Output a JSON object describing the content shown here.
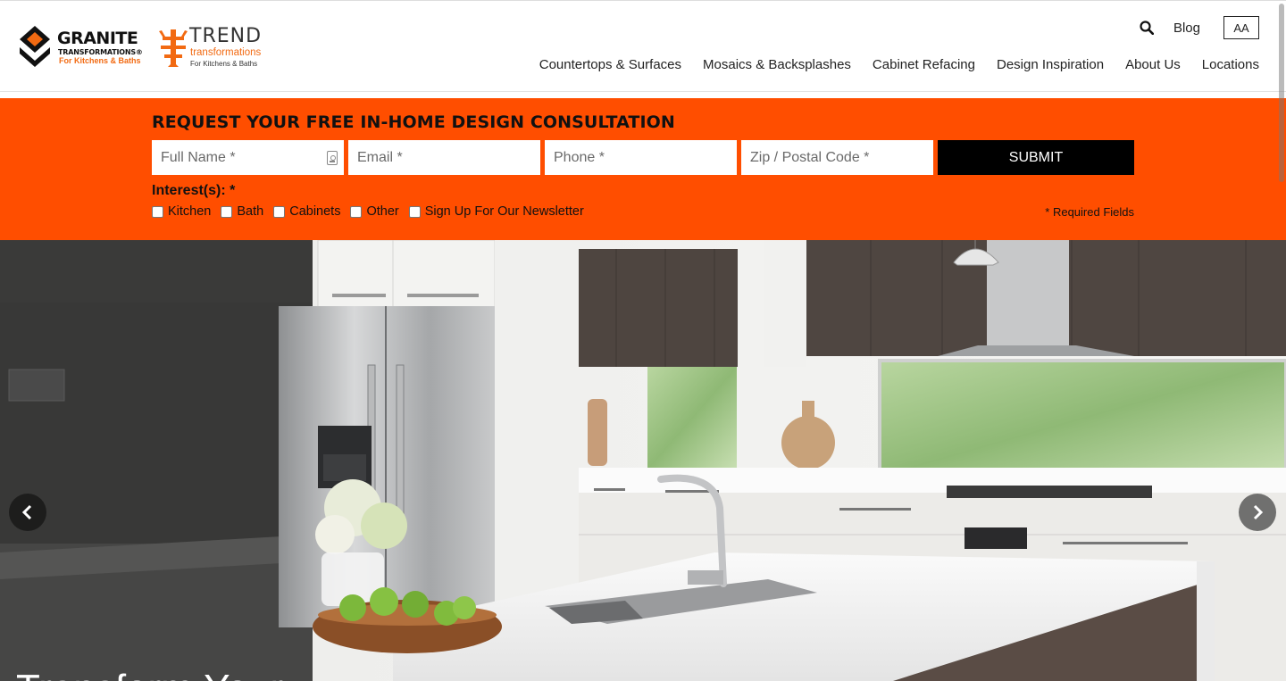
{
  "header": {
    "granite_logo": {
      "title": "GRANITE",
      "subtitle": "TRANSFORMATIONS®",
      "tagline": "For Kitchens & Baths"
    },
    "trend_logo": {
      "title": "TREND",
      "subtitle": "transformations",
      "tagline": "For Kitchens & Baths"
    },
    "utility": {
      "search_icon": "search-icon",
      "blog_label": "Blog",
      "aa_label": "AA"
    },
    "nav": [
      {
        "label": "Countertops & Surfaces"
      },
      {
        "label": "Mosaics & Backsplashes"
      },
      {
        "label": "Cabinet Refacing"
      },
      {
        "label": "Design Inspiration"
      },
      {
        "label": "About Us"
      },
      {
        "label": "Locations"
      }
    ]
  },
  "consultation": {
    "title": "REQUEST YOUR FREE IN-HOME DESIGN CONSULTATION",
    "fields": {
      "full_name_placeholder": "Full Name *",
      "email_placeholder": "Email *",
      "phone_placeholder": "Phone *",
      "zip_placeholder": "Zip / Postal Code *"
    },
    "submit_label": "SUBMIT",
    "interests_label": "Interest(s): *",
    "interests": [
      {
        "label": "Kitchen",
        "checked": false
      },
      {
        "label": "Bath",
        "checked": false
      },
      {
        "label": "Cabinets",
        "checked": false
      },
      {
        "label": "Other",
        "checked": false
      },
      {
        "label": "Sign Up For Our Newsletter",
        "checked": false
      }
    ],
    "required_note": "* Required Fields",
    "accent_color": "#ff4e00"
  },
  "hero": {
    "caption": "Transform Your",
    "prev_icon": "chevron-left-icon",
    "next_icon": "chevron-right-icon"
  }
}
